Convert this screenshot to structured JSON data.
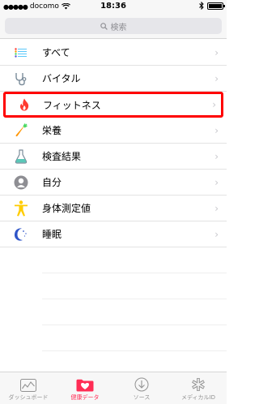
{
  "status_bar": {
    "signal": "●●●●●",
    "carrier": "docomo",
    "time": "18:36"
  },
  "search": {
    "placeholder": "検索"
  },
  "list": {
    "items": [
      {
        "label": "すべて",
        "icon": "list-icon"
      },
      {
        "label": "バイタル",
        "icon": "stethoscope-icon"
      },
      {
        "label": "フィットネス",
        "icon": "flame-icon"
      },
      {
        "label": "栄養",
        "icon": "carrot-icon"
      },
      {
        "label": "検査結果",
        "icon": "flask-icon"
      },
      {
        "label": "自分",
        "icon": "person-head-icon"
      },
      {
        "label": "身体測定値",
        "icon": "body-icon"
      },
      {
        "label": "睡眠",
        "icon": "moon-icon"
      }
    ]
  },
  "tabbar": {
    "tabs": [
      {
        "label": "ダッシュボード"
      },
      {
        "label": "健康データ"
      },
      {
        "label": "ソース"
      },
      {
        "label": "メディカルID"
      }
    ]
  },
  "colors": {
    "accent": "#ff2d55",
    "highlight": "#ff0000",
    "background": "#ffffff"
  }
}
